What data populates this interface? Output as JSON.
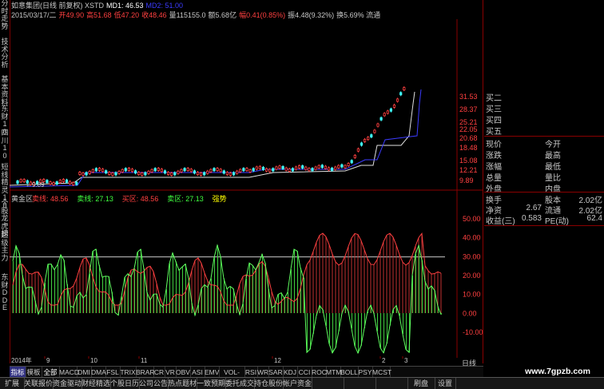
{
  "sidebar": {
    "tabs": [
      "分时走势",
      "技术分析",
      "基本资料",
      "东财10",
      "四川10",
      "短线精灵10",
      "个股龙虎榜",
      "超级主力",
      "东财DDE"
    ]
  },
  "header": {
    "line1": [
      {
        "text": "如意集团(日线 前复权) XSTD",
        "color": "#c8c8c8"
      },
      {
        "text": "MD1: 46.53",
        "color": "#ffffff"
      },
      {
        "text": "MD2: 51.00",
        "color": "#3b3bff"
      }
    ],
    "line2": [
      {
        "text": "2015/03/17/二",
        "color": "#c8c8c8"
      },
      {
        "text": "开49.90",
        "color": "#ff4040"
      },
      {
        "text": "高51.68",
        "color": "#ff4040"
      },
      {
        "text": "低47.20",
        "color": "#ff4040"
      },
      {
        "text": "收48.46",
        "color": "#ff4040"
      },
      {
        "text": "量115155.0",
        "color": "#c8c8c8"
      },
      {
        "text": "额5.68亿",
        "color": "#c8c8c8"
      },
      {
        "text": "幅0.41(0.85%)",
        "color": "#ff4040"
      },
      {
        "text": "振4.48(9.32%)",
        "color": "#c8c8c8"
      },
      {
        "text": "换5.69% 流通",
        "color": "#c8c8c8"
      }
    ]
  },
  "price_axis": [
    "31.53",
    "28.37",
    "25.21",
    "22.05",
    "20.68",
    "18.48",
    "15.08",
    "12.21",
    "9.89"
  ],
  "low_marker": "9.89",
  "indicator": {
    "title": "黄金区",
    "items": [
      {
        "text": "卖线: 48.56",
        "color": "#ff4040"
      },
      {
        "text": "卖线: 27.13",
        "color": "#40ff40"
      },
      {
        "text": "买区: 48.56",
        "color": "#ff4040"
      },
      {
        "text": "卖区: 27.13",
        "color": "#40ff40"
      },
      {
        "text": "强势",
        "color": "#ffff00"
      }
    ],
    "axis": [
      "50.00",
      "40.00",
      "30.00",
      "20.00",
      "10.00",
      "0.00",
      "-10.00"
    ]
  },
  "time_axis": {
    "year": "2014年",
    "labels": [
      "9",
      "10",
      "11",
      "12",
      "2",
      "3"
    ]
  },
  "quote_panel": {
    "buy_levels": [
      "买二",
      "买三",
      "买四",
      "买五"
    ],
    "rows": [
      {
        "l1": "现价",
        "l2": "今开"
      },
      {
        "l1": "涨跌",
        "l2": "最高"
      },
      {
        "l1": "涨幅",
        "l2": "最低"
      },
      {
        "l1": "总量",
        "l2": "量比"
      },
      {
        "l1": "外盘",
        "l2": "内盘"
      }
    ],
    "fin": [
      {
        "l1": "换手",
        "l2": "股本",
        "v2": "2.02亿"
      },
      {
        "l1": "净资",
        "v1": "2.67",
        "l2": "流通",
        "v2": "2.02亿"
      },
      {
        "l1": "收益(三)",
        "v1": "0.583",
        "l2": "PE(动)",
        "v2": "62.4"
      }
    ],
    "daily_label": "日线"
  },
  "tabs": [
    "指标",
    "模板",
    "全部",
    "MACD",
    "DMI",
    "DMA",
    "FSL",
    "TRIX",
    "BRAR",
    "CR",
    "VR",
    "OBV",
    "ASI",
    "EMV",
    "VOL-TDX",
    "RSI",
    "WR",
    "SAR",
    "KDJ",
    "CCI",
    "ROC",
    "MTM",
    "BOLL",
    "PSY",
    "MCST"
  ],
  "function_bar": [
    "扩展",
    "关联报价",
    "资金驱动",
    "财经精选",
    "个股日历",
    "公司公告",
    "热点题材",
    "一致预期",
    "委托成交",
    "持仓股份",
    "帐户资金",
    "",
    "",
    "",
    "刷盘",
    "设置"
  ],
  "watermark": "www.7gpzb.com",
  "colors": {
    "up": "#ff4040",
    "down": "#40ff40",
    "frame": "#8a0000",
    "blue": "#3b3bff"
  }
}
